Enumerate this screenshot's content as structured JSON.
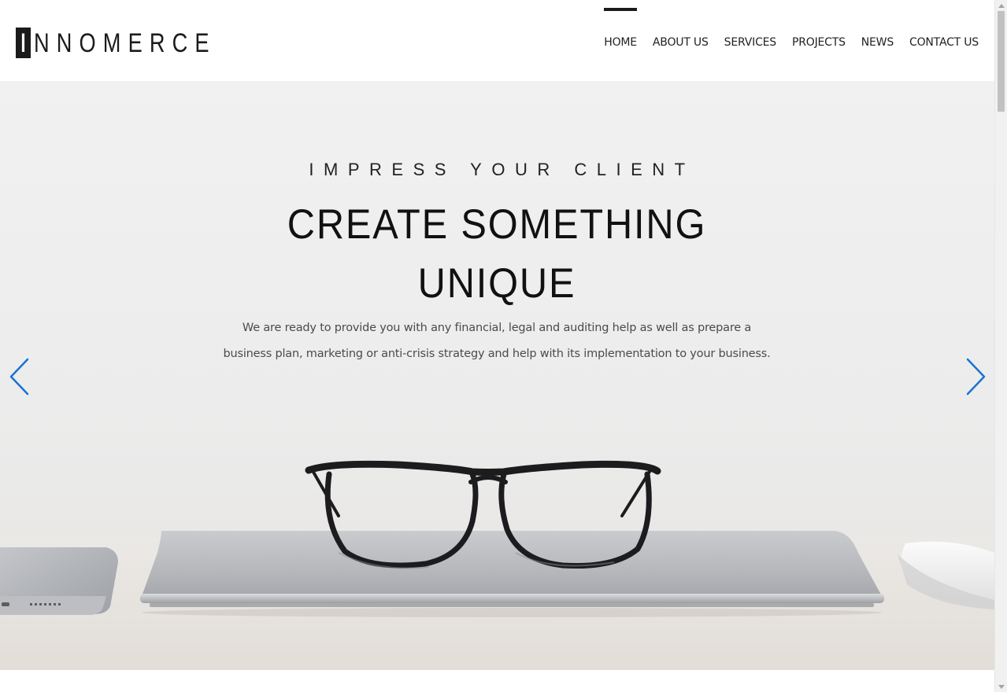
{
  "header": {
    "logo": {
      "initial": "I",
      "rest": "NNOMERCE"
    },
    "nav": [
      {
        "label": "HOME",
        "active": true
      },
      {
        "label": "ABOUT US",
        "active": false
      },
      {
        "label": "SERVICES",
        "active": false
      },
      {
        "label": "PROJECTS",
        "active": false
      },
      {
        "label": "NEWS",
        "active": false
      },
      {
        "label": "CONTACT US",
        "active": false
      }
    ]
  },
  "hero": {
    "kicker": "IMPRESS YOUR CLIENT",
    "title_line1": "CREATE SOMETHING",
    "title_line2": "UNIQUE",
    "description_line1": "We are ready to provide you with any financial, legal and auditing help as well as prepare a",
    "description_line2": "business plan, marketing or anti-crisis strategy and help with its implementation to your business.",
    "prev_icon": "chevron-left-icon",
    "next_icon": "chevron-right-icon",
    "accent_color": "#1a73d1"
  }
}
